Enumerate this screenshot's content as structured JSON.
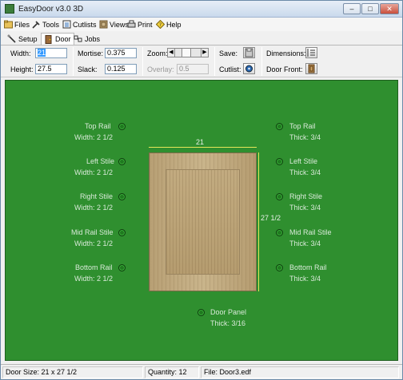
{
  "window": {
    "title": "EasyDoor v3.0 3D",
    "min_glyph": "–",
    "max_glyph": "□",
    "close_glyph": "✕"
  },
  "menu": {
    "items": [
      {
        "label": "Files",
        "icon": "files-icon"
      },
      {
        "label": "Tools",
        "icon": "tools-icon"
      },
      {
        "label": "Cutlists",
        "icon": "cutlists-icon"
      },
      {
        "label": "Views",
        "icon": "views-icon"
      },
      {
        "label": "Print",
        "icon": "print-icon"
      },
      {
        "label": "Help",
        "icon": "help-icon"
      }
    ]
  },
  "tabs": [
    {
      "label": "Setup",
      "icon": "setup-icon"
    },
    {
      "label": "Door",
      "icon": "door-icon"
    },
    {
      "label": "Jobs",
      "icon": "jobs-icon"
    }
  ],
  "fields": {
    "width_label": "Width:",
    "width_value": "21",
    "height_label": "Height:",
    "height_value": "27.5",
    "mortise_label": "Mortise:",
    "mortise_value": "0.375",
    "slack_label": "Slack:",
    "slack_value": "0.125",
    "zoom_label": "Zoom:",
    "overlay_label": "Overlay:",
    "overlay_value": "0.5",
    "save_label": "Save:",
    "cutlist_label": "Cutlist:",
    "dimensions_label": "Dimensions:",
    "door_front_label": "Door Front:"
  },
  "canvas": {
    "left_parts": [
      {
        "name": "Top Rail",
        "detail": "Width: 2 1/2"
      },
      {
        "name": "Left Stile",
        "detail": "Width: 2 1/2"
      },
      {
        "name": "Right Stile",
        "detail": "Width: 2 1/2"
      },
      {
        "name": "Mid Rail Stile",
        "detail": "Width: 2 1/2"
      },
      {
        "name": "Bottom Rail",
        "detail": "Width: 2 1/2"
      }
    ],
    "right_parts": [
      {
        "name": "Top Rail",
        "detail": "Thick: 3/4"
      },
      {
        "name": "Left Stile",
        "detail": "Thick: 3/4"
      },
      {
        "name": "Right Stile",
        "detail": "Thick: 3/4"
      },
      {
        "name": "Mid Rail Stile",
        "detail": "Thick: 3/4"
      },
      {
        "name": "Bottom Rail",
        "detail": "Thick: 3/4"
      }
    ],
    "panel_part": {
      "name": "Door Panel",
      "detail": "Thick: 3/16"
    },
    "dim_width": "21",
    "dim_height": "27 1/2",
    "background_color": "#2f8f2f"
  },
  "status": {
    "door_size": "Door Size: 21  x 27 1/2",
    "quantity": "Quantity: 12",
    "file": "File: Door3.edf"
  }
}
